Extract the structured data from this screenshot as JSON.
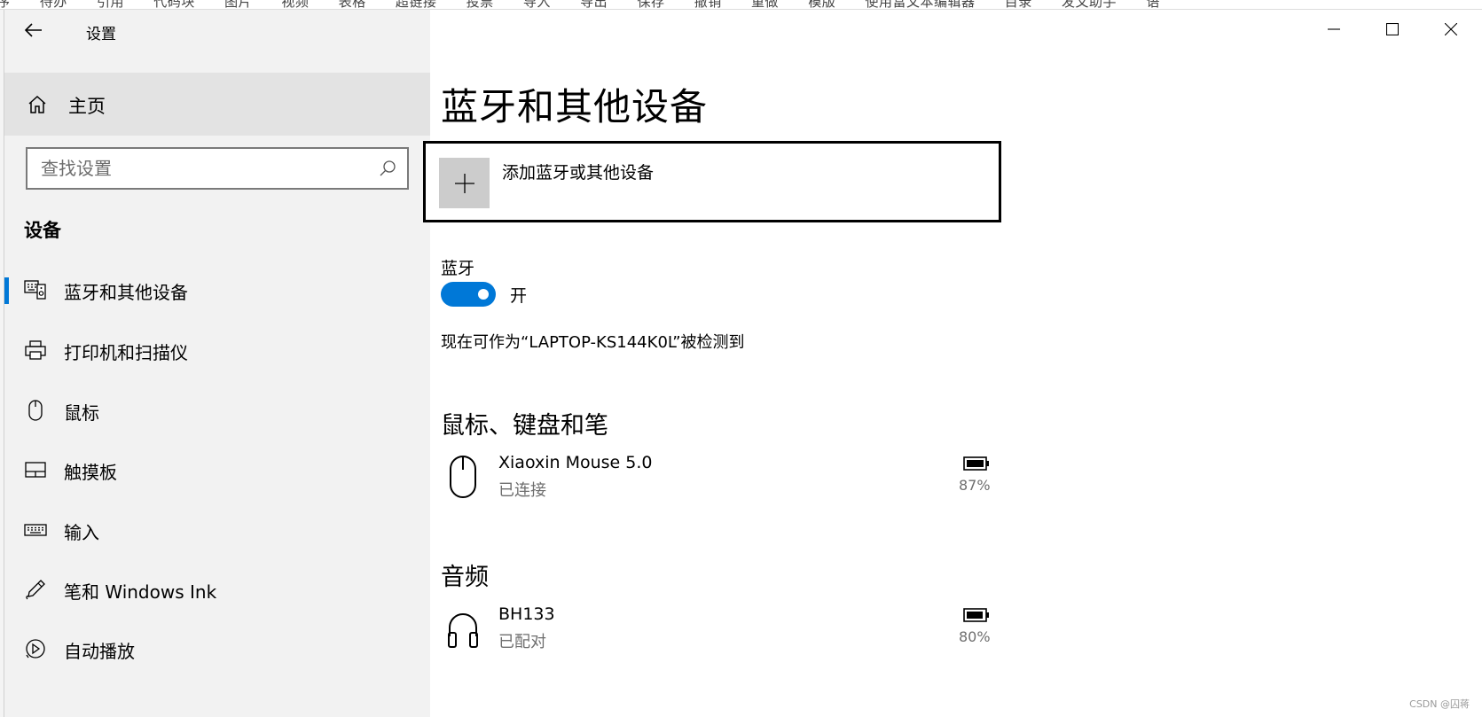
{
  "background_app": {
    "menu_text": "序 待办 引用 代码块 图片 视频 表格 超链接 投票 导入 导出 保存 撤销 重做 模版 使用富文本编辑器 目录 发文助手 语"
  },
  "app": {
    "title": "设置",
    "home_label": "主页",
    "search_placeholder": "查找设置",
    "section_heading": "设备"
  },
  "sidebar": {
    "items": [
      {
        "label": "蓝牙和其他设备",
        "icon": "bluetooth-devices-icon",
        "selected": true
      },
      {
        "label": "打印机和扫描仪",
        "icon": "printer-icon",
        "selected": false
      },
      {
        "label": "鼠标",
        "icon": "mouse-icon",
        "selected": false
      },
      {
        "label": "触摸板",
        "icon": "touchpad-icon",
        "selected": false
      },
      {
        "label": "输入",
        "icon": "keyboard-icon",
        "selected": false
      },
      {
        "label": "笔和 Windows Ink",
        "icon": "pen-icon",
        "selected": false
      },
      {
        "label": "自动播放",
        "icon": "autoplay-icon",
        "selected": false
      }
    ]
  },
  "main": {
    "page_title": "蓝牙和其他设备",
    "add_device_label": "添加蓝牙或其他设备",
    "bluetooth": {
      "label": "蓝牙",
      "state": "开",
      "on": true,
      "discoverable_text": "现在可作为“LAPTOP-KS144K0L”被检测到"
    },
    "groups": [
      {
        "heading": "鼠标、键盘和笔",
        "devices": [
          {
            "name": "Xiaoxin Mouse 5.0",
            "status": "已连接",
            "battery": "87%",
            "icon": "mouse-icon"
          }
        ]
      },
      {
        "heading": "音频",
        "devices": [
          {
            "name": "BH133",
            "status": "已配对",
            "battery": "80%",
            "icon": "headphones-icon"
          }
        ]
      }
    ]
  },
  "watermark": "CSDN @囚蒋",
  "colors": {
    "accent": "#0078d7",
    "sidebar_bg": "#f2f2f2",
    "selected_bg": "#e3e3e3"
  }
}
